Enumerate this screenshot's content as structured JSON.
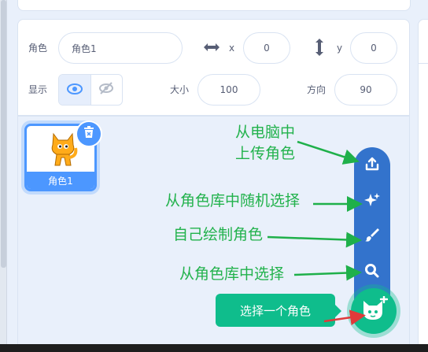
{
  "sprite_info": {
    "sprite_label": "角色",
    "sprite_name_value": "角色1",
    "x_label": "x",
    "x_value": "0",
    "y_label": "y",
    "y_value": "0",
    "show_label": "显示",
    "size_label": "大小",
    "size_value": "100",
    "direction_label": "方向",
    "direction_value": "90"
  },
  "sprite_list": {
    "items": [
      {
        "name": "角色1",
        "selected": true
      }
    ]
  },
  "sprite_menu": {
    "tooltip": "选择一个角色",
    "items": [
      "upload-icon",
      "surprise-icon",
      "paint-icon",
      "search-icon"
    ],
    "main_icon": "cat-add-icon"
  },
  "annotations": {
    "upload_line1": "从电脑中",
    "upload_line2": "上传角色",
    "surprise": "从角色库中随机选择",
    "paint": "自己绘制角色",
    "search": "从角色库中选择"
  },
  "colors": {
    "accent": "#4c97ff",
    "menu_dark": "#3373cc",
    "main_button": "#0fbd8c",
    "annotation": "#22b24c",
    "arrow_green": "#1fb04a",
    "arrow_red": "#e03a3a"
  }
}
